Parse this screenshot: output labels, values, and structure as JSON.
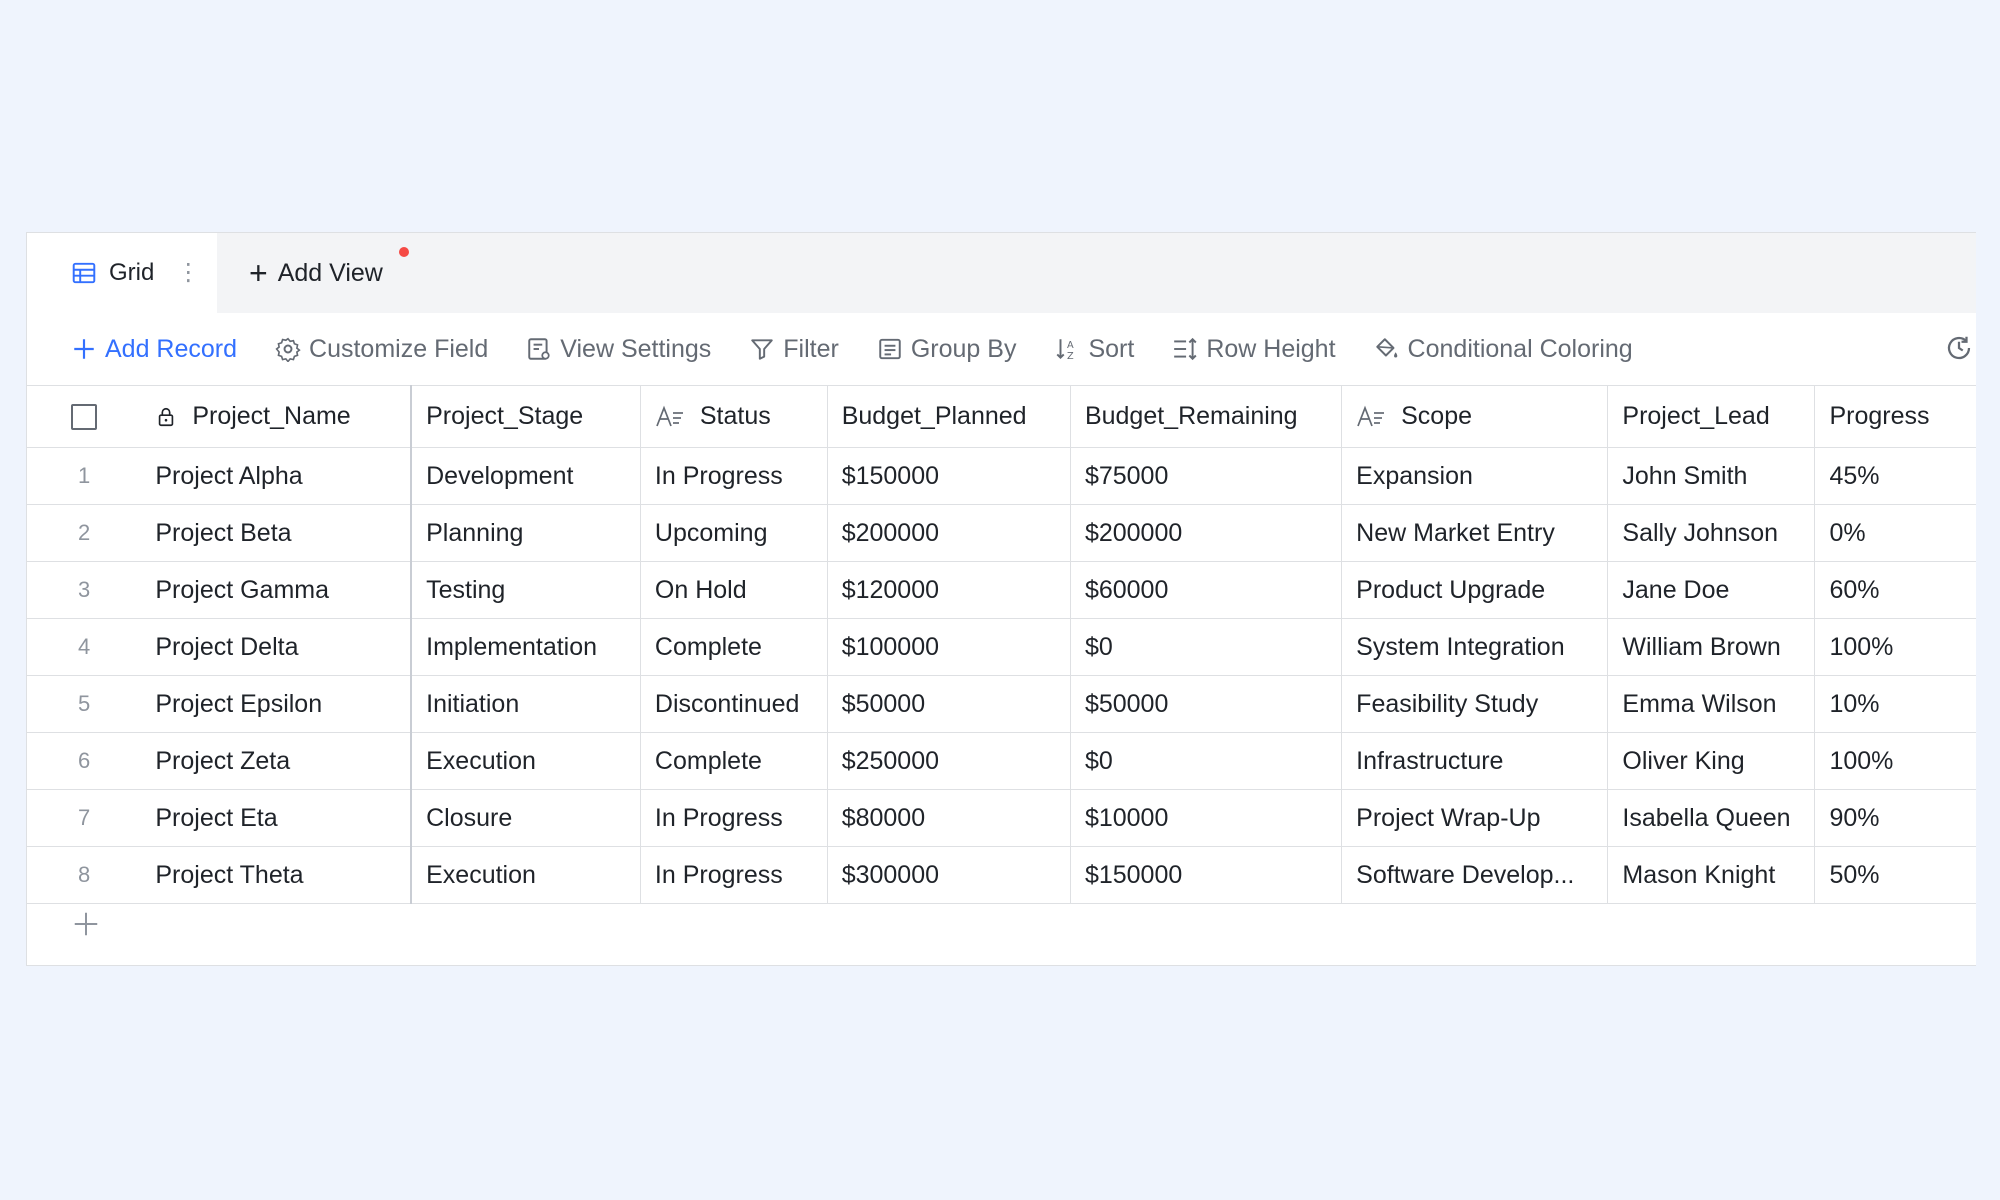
{
  "tabs": {
    "active_label": "Grid",
    "add_view_label": "Add View"
  },
  "toolbar": {
    "add_record": "Add Record",
    "customize_field": "Customize Field",
    "view_settings": "View Settings",
    "filter": "Filter",
    "group_by": "Group By",
    "sort": "Sort",
    "row_height": "Row Height",
    "conditional_coloring": "Conditional Coloring"
  },
  "colors": {
    "accent": "#3370ff",
    "notification": "#f54a45",
    "background": "#eff4fd"
  },
  "table": {
    "columns": [
      "Project_Name",
      "Project_Stage",
      "Status",
      "Budget_Planned",
      "Budget_Remaining",
      "Scope",
      "Project_Lead",
      "Progress"
    ],
    "rows": [
      [
        "1",
        "Project Alpha",
        "Development",
        "In Progress",
        "$150000",
        "$75000",
        "Expansion",
        "John Smith",
        "45%"
      ],
      [
        "2",
        "Project Beta",
        "Planning",
        "Upcoming",
        "$200000",
        "$200000",
        "New Market Entry",
        "Sally Johnson",
        "0%"
      ],
      [
        "3",
        "Project Gamma",
        "Testing",
        "On Hold",
        "$120000",
        "$60000",
        "Product Upgrade",
        "Jane Doe",
        "60%"
      ],
      [
        "4",
        "Project Delta",
        "Implementation",
        "Complete",
        "$100000",
        "$0",
        "System Integration",
        "William Brown",
        "100%"
      ],
      [
        "5",
        "Project Epsilon",
        "Initiation",
        "Discontinued",
        "$50000",
        "$50000",
        "Feasibility Study",
        "Emma Wilson",
        "10%"
      ],
      [
        "6",
        "Project Zeta",
        "Execution",
        "Complete",
        "$250000",
        "$0",
        "Infrastructure",
        "Oliver King",
        "100%"
      ],
      [
        "7",
        "Project Eta",
        "Closure",
        "In Progress",
        "$80000",
        "$10000",
        "Project Wrap-Up",
        "Isabella Queen",
        "90%"
      ],
      [
        "8",
        "Project Theta",
        "Execution",
        "In Progress",
        "$300000",
        "$150000",
        "Software Develop...",
        "Mason Knight",
        "50%"
      ]
    ]
  }
}
